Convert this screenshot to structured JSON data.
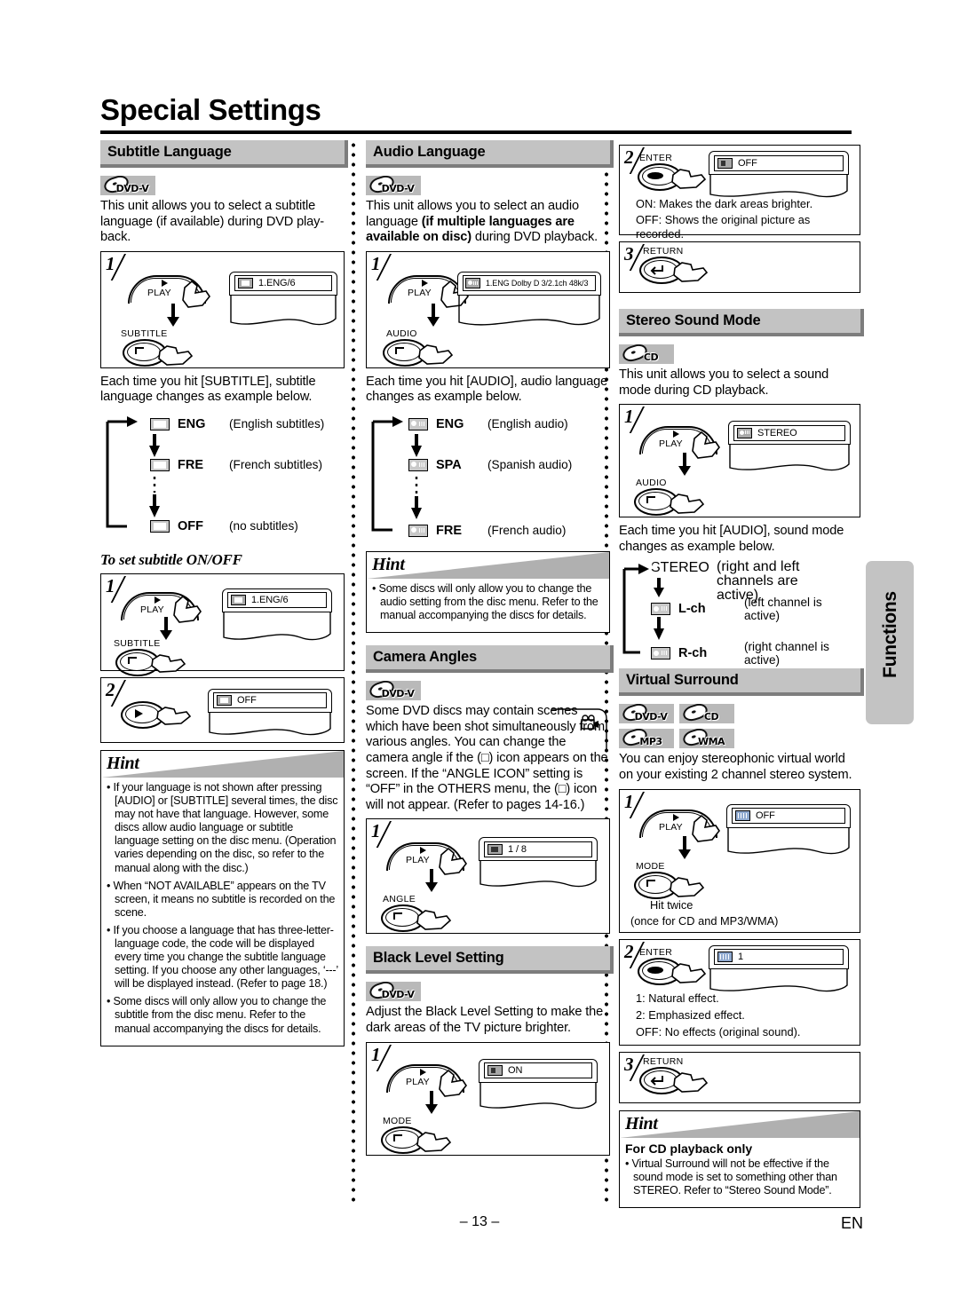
{
  "page": {
    "title": "Special Settings",
    "number": "– 13 –",
    "lang_code": "EN",
    "side_tab": "Functions"
  },
  "sections": {
    "subtitle_language": {
      "heading": "Subtitle Language",
      "badges": [
        "DVD-V"
      ],
      "intro": "This unit allows you to select a subtitle language (if available) during DVD play-back.",
      "step1": {
        "num": "1",
        "play_label": "PLAY",
        "button_label": "SUBTITLE",
        "osd_text": "1.ENG/6",
        "osd_icon": "subtitle-icon"
      },
      "after_step": "Each time you hit [SUBTITLE], subtitle language changes as example below.",
      "sequence": [
        {
          "icon": "subtitle-icon",
          "code": "ENG",
          "desc": "(English subtitles)"
        },
        {
          "icon": "subtitle-icon",
          "code": "FRE",
          "desc": "(French subtitles)"
        },
        {
          "icon": "subtitle-icon",
          "code": "OFF",
          "desc": "(no subtitles)"
        }
      ],
      "subheading": "To set subtitle ON/OFF",
      "onoff_step1": {
        "num": "1",
        "play_label": "PLAY",
        "button_label": "SUBTITLE",
        "osd_text": "1.ENG/6"
      },
      "onoff_step2": {
        "num": "2",
        "osd_text": "OFF"
      },
      "hint": {
        "title": "Hint",
        "items": [
          "If your language is not shown after pressing [AUDIO] or [SUBTITLE] several times, the disc may not have that language. However, some discs allow audio language or subtitle language setting on the disc menu. (Operation varies depending on the disc, so refer to the manual along with the disc.)",
          "When “NOT AVAILABLE” appears on the TV screen, it means no subtitle is recorded on the scene.",
          "If you choose a language that has three-letter-language code, the code will be displayed every time you change the subtitle language setting. If you choose any other languages, ‘---’ will be displayed instead. (Refer to page 18.)",
          "Some discs will only allow you to change the subtitle from the disc menu. Refer to the manual accompanying the discs for details."
        ]
      }
    },
    "audio_language": {
      "heading": "Audio Language",
      "badges": [
        "DVD-V"
      ],
      "intro_plain1": "This unit allows you to select an audio language ",
      "intro_bold": "(if multiple languages are available on disc)",
      "intro_plain2": " during DVD playback.",
      "step1": {
        "num": "1",
        "play_label": "PLAY",
        "button_label": "AUDIO",
        "osd_text": "1.ENG  Dolby D  3/2.1ch  48k/3",
        "osd_icon": "audio-icon"
      },
      "after_step": "Each time you hit [AUDIO], audio language changes as example below.",
      "sequence": [
        {
          "icon": "audio-icon",
          "code": "ENG",
          "desc": "(English audio)"
        },
        {
          "icon": "audio-icon",
          "code": "SPA",
          "desc": "(Spanish audio)"
        },
        {
          "icon": "audio-icon",
          "code": "FRE",
          "desc": "(French audio)"
        }
      ],
      "hint": {
        "title": "Hint",
        "items": [
          "Some discs will only allow you to change the audio setting from the disc menu. Refer to the manual accompanying the discs for details."
        ]
      }
    },
    "camera_angles": {
      "heading": "Camera Angles",
      "badges": [
        "DVD-V"
      ],
      "intro": "Some DVD discs may contain scenes which have been shot simultaneously from various angles. You can change the camera angle if the (□) icon appears on the screen. If the “ANGLE ICON” setting is “OFF” in the OTHERS menu, the (□) icon will not appear. (Refer to pages 14-16.)",
      "step1": {
        "num": "1",
        "play_label": "PLAY",
        "button_label": "ANGLE",
        "osd_text": "1 / 8",
        "osd_icon": "angle-icon"
      }
    },
    "black_level_setting": {
      "heading": "Black Level Setting",
      "badges": [
        "DVD-V"
      ],
      "intro": "Adjust the Black Level Setting to make the dark areas of the TV picture brighter.",
      "step1": {
        "num": "1",
        "play_label": "PLAY",
        "button_label": "MODE",
        "osd_text": "ON",
        "osd_icon": "black-level-icon"
      },
      "step2": {
        "num": "2",
        "button_label": "ENTER",
        "osd_text": "OFF",
        "note_on": "ON: Makes the dark areas brighter.",
        "note_off": "OFF: Shows the original picture as recorded."
      },
      "step3": {
        "num": "3",
        "button_label": "RETURN"
      }
    },
    "stereo_sound_mode": {
      "heading": "Stereo Sound Mode",
      "badges": [
        "CD"
      ],
      "intro": "This unit allows you to select a sound mode during CD playback.",
      "step1": {
        "num": "1",
        "play_label": "PLAY",
        "button_label": "AUDIO",
        "osd_text": "STEREO",
        "osd_icon": "audio-icon"
      },
      "after_step": "Each time you hit [AUDIO], sound mode changes as example below.",
      "sequence": [
        {
          "icon": "audio-icon",
          "code": "STEREO",
          "desc": "(right and left channels are active)"
        },
        {
          "icon": "audio-icon",
          "code": "L-ch",
          "desc": "(left channel is active)"
        },
        {
          "icon": "audio-icon",
          "code": "R-ch",
          "desc": "(right channel is active)"
        }
      ]
    },
    "virtual_surround": {
      "heading": "Virtual Surround",
      "badges": [
        "DVD-V",
        "CD",
        "MP3",
        "WMA"
      ],
      "intro": "You can enjoy stereophonic virtual world on your existing 2 channel stereo system.",
      "step1": {
        "num": "1",
        "play_label": "PLAY",
        "button_label": "MODE",
        "osd_text": "OFF",
        "osd_icon": "virtual-surround-icon",
        "note1": "Hit twice",
        "note2": "(once for CD and MP3/WMA)"
      },
      "step2": {
        "num": "2",
        "button_label": "ENTER",
        "osd_text": "1",
        "note1": "1: Natural effect.",
        "note2": "2: Emphasized effect.",
        "note3": "OFF: No effects (original sound)."
      },
      "step3": {
        "num": "3",
        "button_label": "RETURN"
      },
      "hint": {
        "title": "Hint",
        "subtitle": "For CD playback only",
        "items": [
          "Virtual Surround will not be effective if the sound mode is set to something other than STEREO. Refer to “Stereo Sound Mode”."
        ]
      }
    }
  },
  "colors": {
    "header_bar": "#c3c3c3",
    "header_shadow": "#7d7d7d",
    "badge_bg": "#b9b9b9",
    "hint_wedge": "#b0b0b0"
  }
}
